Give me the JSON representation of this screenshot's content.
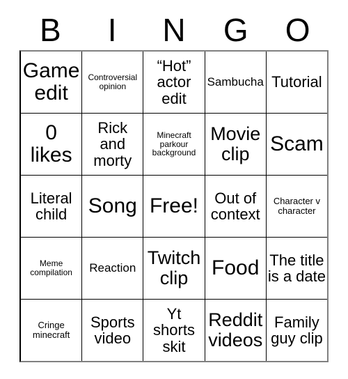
{
  "card": {
    "header": {
      "letters": [
        "B",
        "I",
        "N",
        "G",
        "O"
      ]
    },
    "rows": [
      [
        {
          "text": "Game edit",
          "size": "fs-xl"
        },
        {
          "text": "Controversial opinion",
          "size": "fs-xxs"
        },
        {
          "text": "“Hot” actor edit",
          "size": "fs-md"
        },
        {
          "text": "Sambucha",
          "size": "fs-sm"
        },
        {
          "text": "Tutorial",
          "size": "fs-md"
        }
      ],
      [
        {
          "text": "0 likes",
          "size": "fs-xl"
        },
        {
          "text": "Rick and morty",
          "size": "fs-md"
        },
        {
          "text": "Minecraft parkour background",
          "size": "fs-xxs"
        },
        {
          "text": "Movie clip",
          "size": "fs-lg"
        },
        {
          "text": "Scam",
          "size": "fs-xl"
        }
      ],
      [
        {
          "text": "Literal child",
          "size": "fs-md"
        },
        {
          "text": "Song",
          "size": "fs-xl"
        },
        {
          "text": "Free!",
          "size": "fs-xl"
        },
        {
          "text": "Out of context",
          "size": "fs-md"
        },
        {
          "text": "Character v character",
          "size": "fs-xs"
        }
      ],
      [
        {
          "text": "Meme compilation",
          "size": "fs-xxs"
        },
        {
          "text": "Reaction",
          "size": "fs-sm"
        },
        {
          "text": "Twitch clip",
          "size": "fs-lg"
        },
        {
          "text": "Food",
          "size": "fs-xl"
        },
        {
          "text": "The title is a date",
          "size": "fs-md"
        }
      ],
      [
        {
          "text": "Cringe minecraft",
          "size": "fs-xs"
        },
        {
          "text": "Sports video",
          "size": "fs-md"
        },
        {
          "text": "Yt shorts skit",
          "size": "fs-md"
        },
        {
          "text": "Reddit videos",
          "size": "fs-lg"
        },
        {
          "text": "Family guy clip",
          "size": "fs-md"
        }
      ]
    ]
  },
  "colors": {
    "background": "#ffffff",
    "text": "#000000",
    "grid_line": "#000000",
    "outer_border": "#808080"
  }
}
